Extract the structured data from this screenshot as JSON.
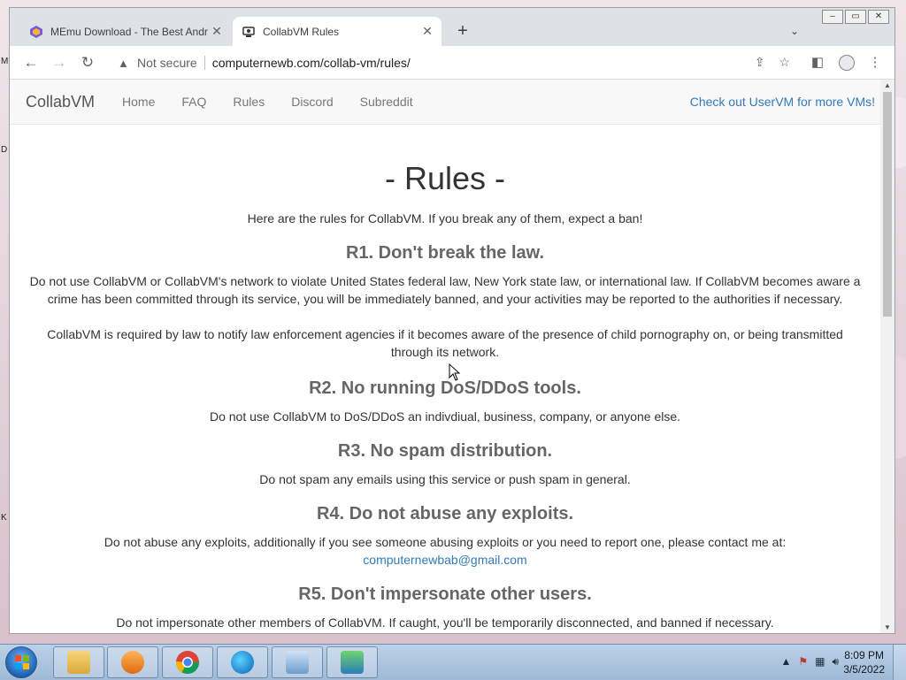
{
  "browser": {
    "tabs": [
      {
        "title": "MEmu Download - The Best Andr",
        "active": false
      },
      {
        "title": "CollabVM Rules",
        "active": true
      }
    ],
    "new_tab": "+",
    "address": {
      "security_label": "Not secure",
      "url": "computernewb.com/collab-vm/rules/"
    }
  },
  "site": {
    "brand": "CollabVM",
    "nav": [
      "Home",
      "FAQ",
      "Rules",
      "Discord",
      "Subreddit"
    ],
    "nav_right": "Check out UserVM for more VMs!"
  },
  "page": {
    "title": "- Rules -",
    "intro": "Here are the rules for CollabVM. If you break any of them, expect a ban!",
    "rules": [
      {
        "heading": "R1. Don't break the law.",
        "paragraphs": [
          "Do not use CollabVM or CollabVM's network to violate United States federal law, New York state law, or international law. If CollabVM becomes aware a crime has been committed through its service, you will be immediately banned, and your activities may be reported to the authorities if necessary.",
          "CollabVM is required by law to notify law enforcement agencies if it becomes aware of the presence of child pornography on, or being transmitted through its network."
        ]
      },
      {
        "heading": "R2. No running DoS/DDoS tools.",
        "paragraphs": [
          "Do not use CollabVM to DoS/DDoS an indivdiual, business, company, or anyone else."
        ]
      },
      {
        "heading": "R3. No spam distribution.",
        "paragraphs": [
          "Do not spam any emails using this service or push spam in general."
        ]
      },
      {
        "heading": "R4. Do not abuse any exploits.",
        "paragraphs": [
          "Do not abuse any exploits, additionally if you see someone abusing exploits or you need to report one, please contact me at:"
        ],
        "email": "computernewbab@gmail.com"
      },
      {
        "heading": "R5. Don't impersonate other users.",
        "paragraphs": [
          "Do not impersonate other members of CollabVM. If caught, you'll be temporarily disconnected, and banned if necessary."
        ]
      }
    ]
  },
  "taskbar": {
    "clock_time": "8:09 PM",
    "clock_date": "3/5/2022"
  },
  "colors": {
    "link": "#337ab7",
    "heading": "#666666",
    "text": "#333333"
  }
}
